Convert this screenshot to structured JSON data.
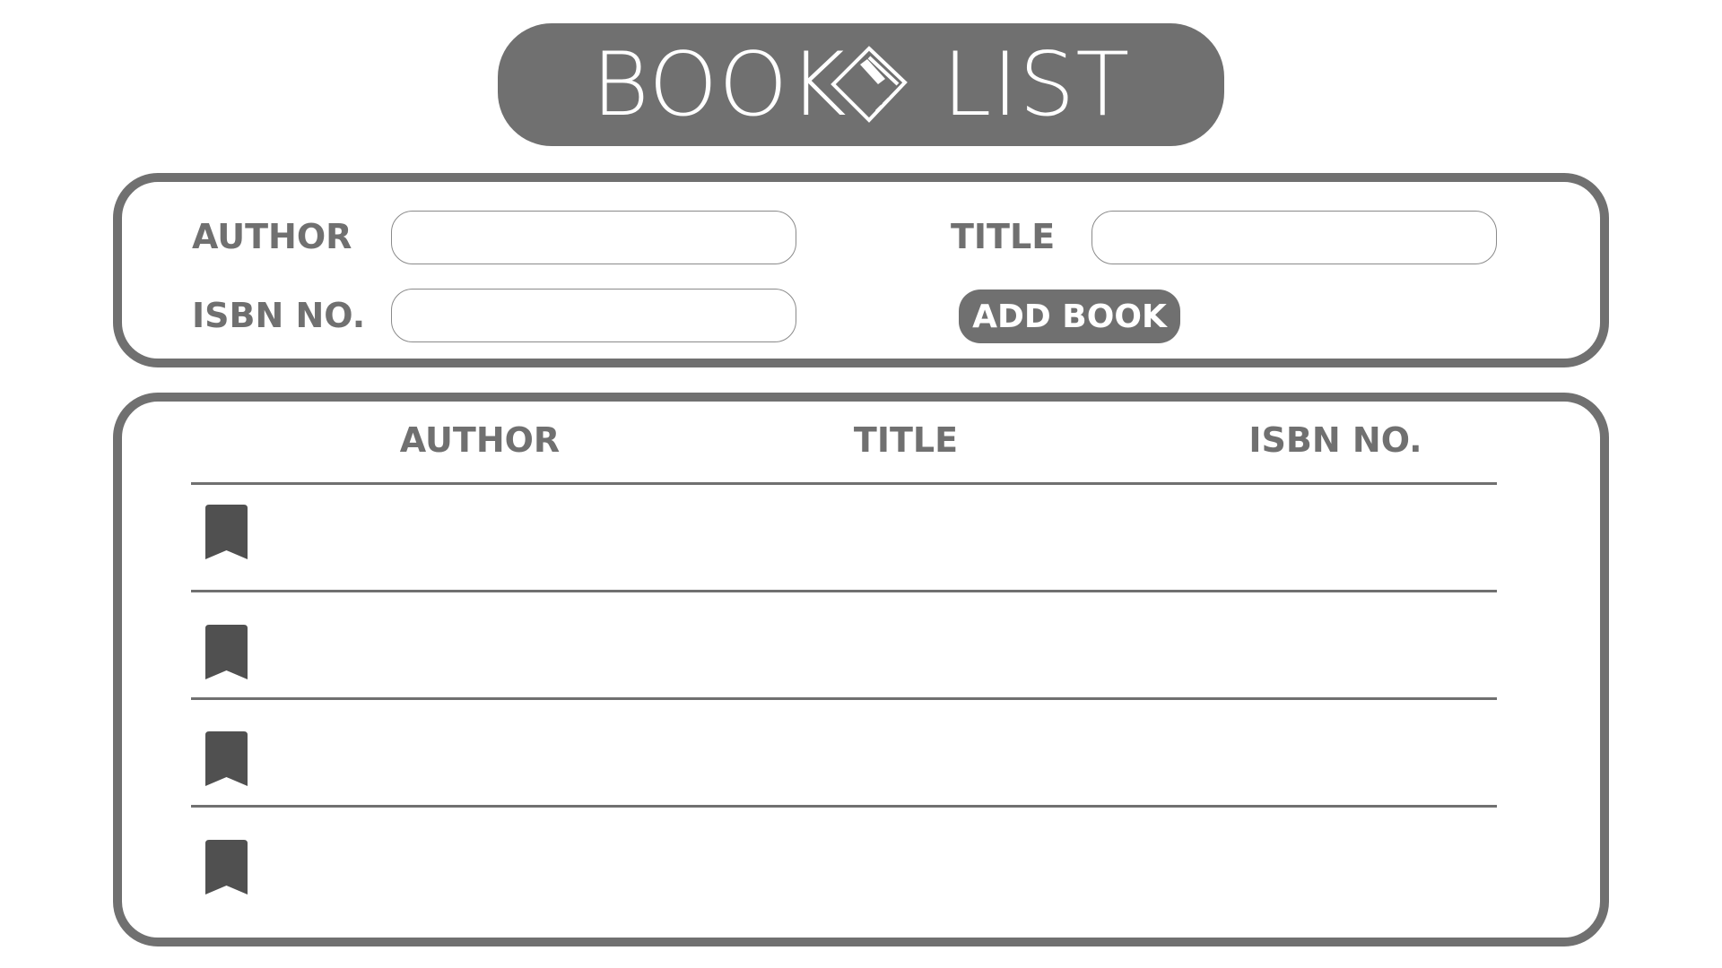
{
  "header": {
    "title_word_1": "BOOK",
    "title_word_2": "LIST",
    "icon": "book-icon"
  },
  "form": {
    "author_label": "AUTHOR",
    "title_label": "TITLE",
    "isbn_label": "ISBN NO.",
    "author_value": "",
    "title_value": "",
    "isbn_value": "",
    "add_button": "ADD BOOK"
  },
  "list": {
    "columns": [
      "AUTHOR",
      "TITLE",
      "ISBN NO."
    ],
    "rows": [
      {
        "icon": "bookmark-icon",
        "author": "",
        "title": "",
        "isbn": ""
      },
      {
        "icon": "bookmark-icon",
        "author": "",
        "title": "",
        "isbn": ""
      },
      {
        "icon": "bookmark-icon",
        "author": "",
        "title": "",
        "isbn": ""
      },
      {
        "icon": "bookmark-icon",
        "author": "",
        "title": "",
        "isbn": ""
      }
    ]
  },
  "colors": {
    "primary": "#707070",
    "bookmark": "#505050",
    "background": "#ffffff"
  }
}
